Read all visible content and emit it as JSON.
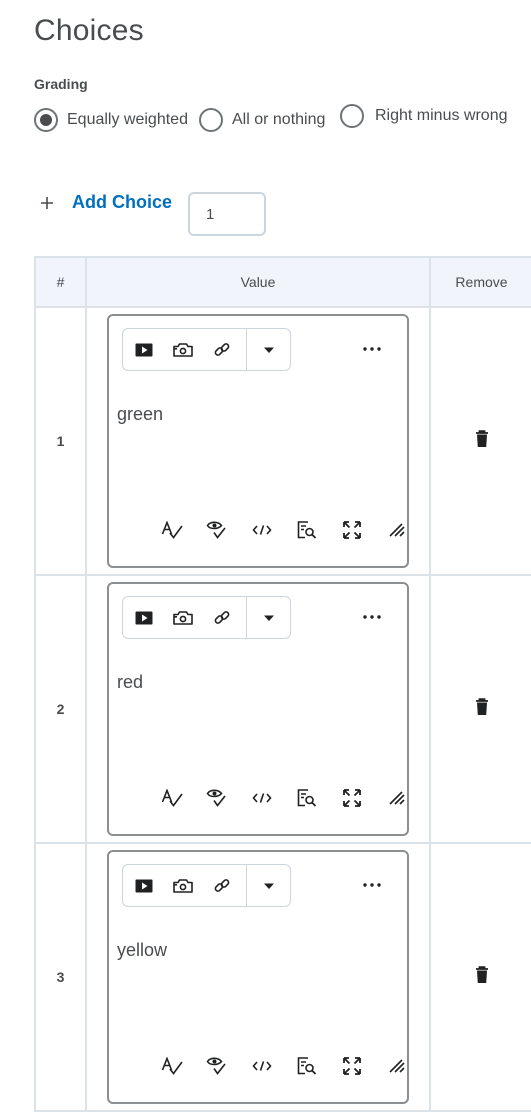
{
  "title": "Choices",
  "grading": {
    "label": "Grading",
    "options": [
      {
        "label": "Equally weighted",
        "checked": true
      },
      {
        "label": "All or nothing",
        "checked": false
      },
      {
        "label": "Right minus wrong",
        "checked": false
      }
    ]
  },
  "add_choice": {
    "label": "Add Choice",
    "count": "1"
  },
  "table": {
    "headers": {
      "num": "#",
      "value": "Value",
      "remove": "Remove"
    },
    "rows": [
      {
        "num": "1",
        "value": "green"
      },
      {
        "num": "2",
        "value": "red"
      },
      {
        "num": "3",
        "value": "yellow"
      }
    ]
  },
  "colors": {
    "link": "#006fbf",
    "text": "#494c4e",
    "header_bg": "#f1f5fb",
    "border": "#dce3e8"
  },
  "icons": {
    "toolbar": [
      "video-icon",
      "camera-icon",
      "link-icon",
      "chevron-down-icon",
      "more-icon"
    ],
    "bottom": [
      "spellcheck-icon",
      "accessibility-check-icon",
      "source-code-icon",
      "preview-icon",
      "fullscreen-icon",
      "resize-handle-icon"
    ],
    "remove": "trash-icon"
  }
}
